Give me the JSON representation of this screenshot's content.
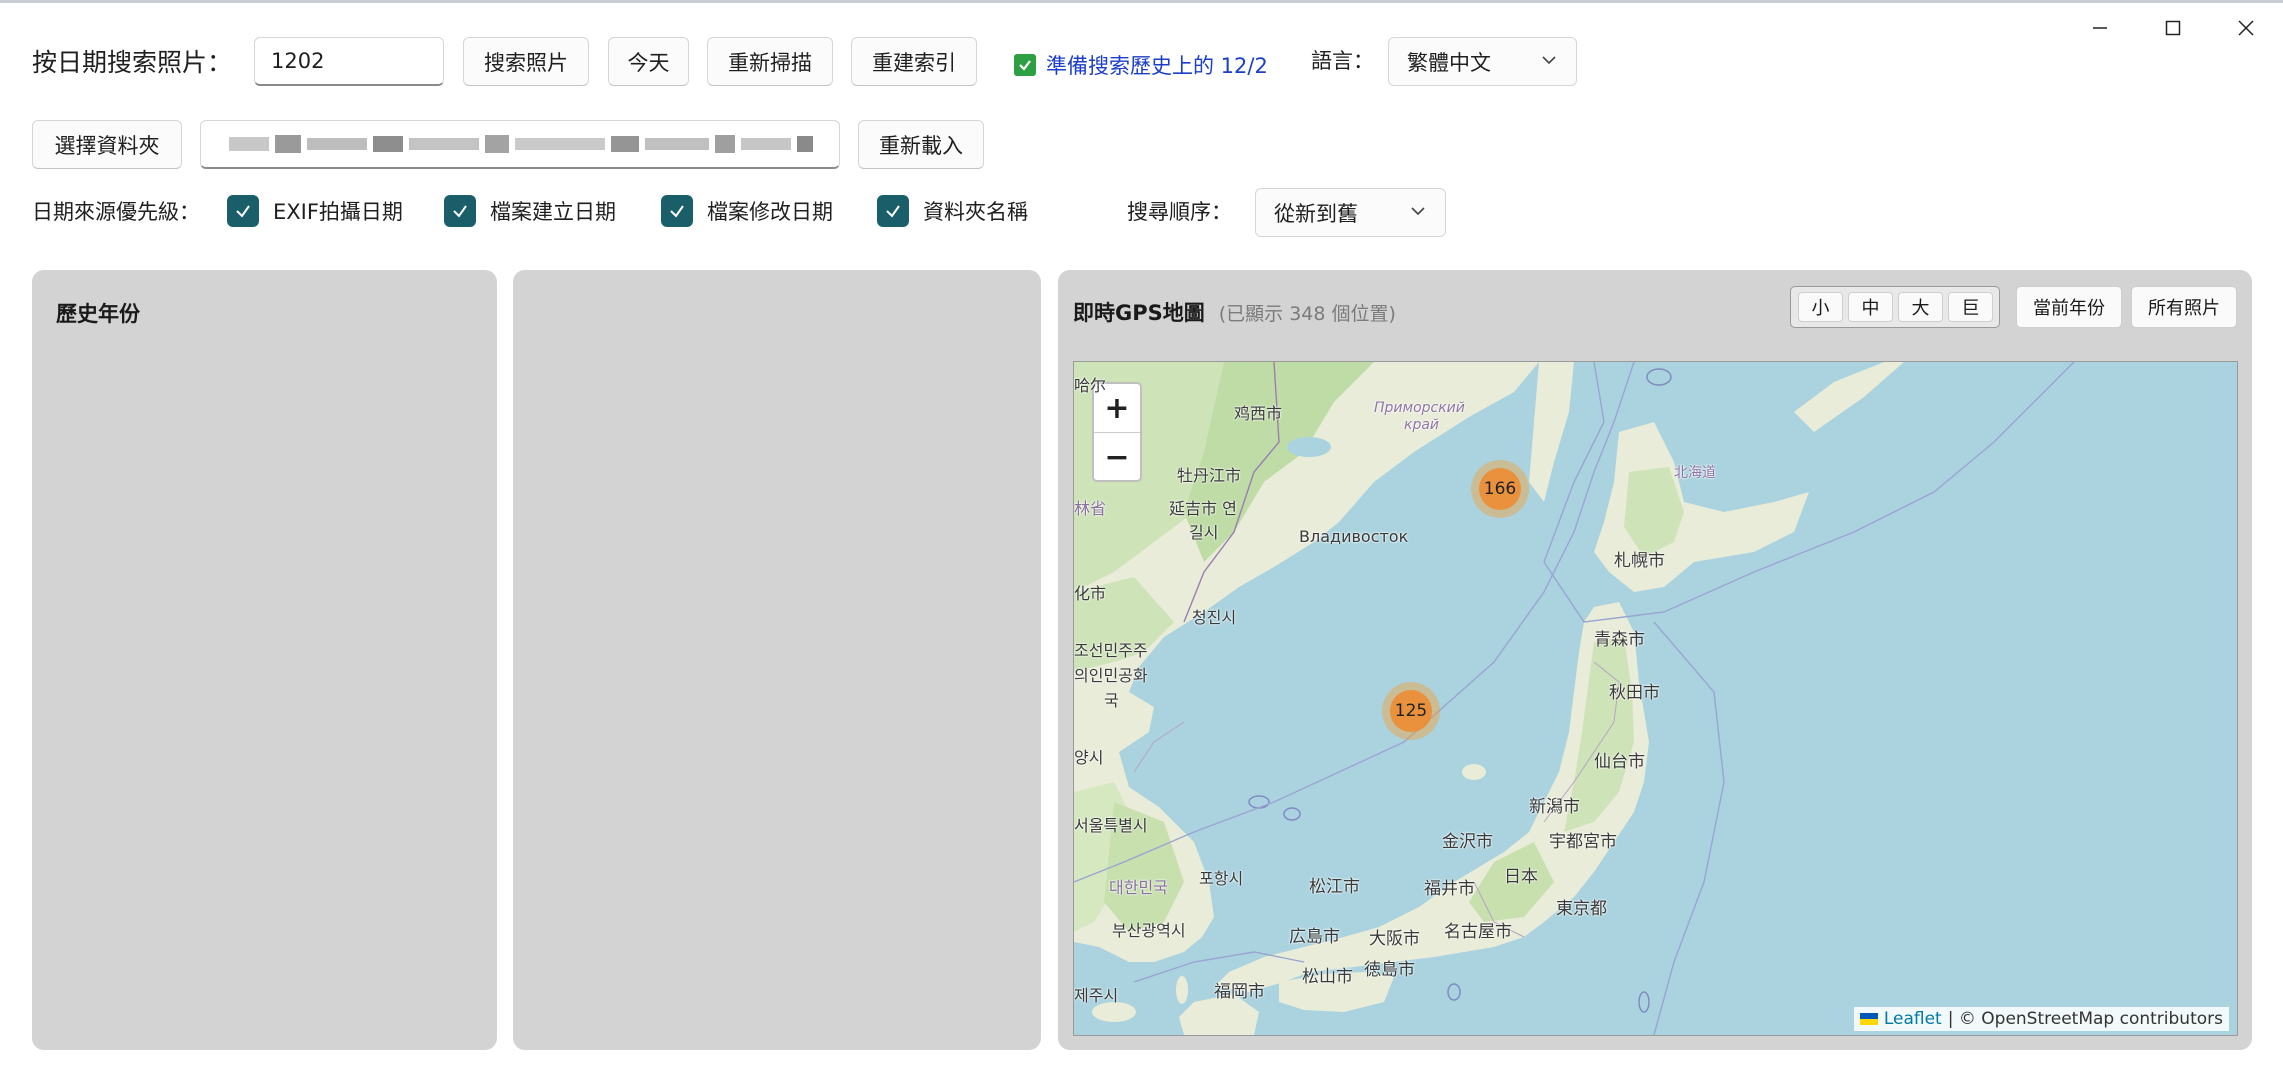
{
  "window": {
    "minimize": "minimize",
    "maximize": "maximize",
    "close": "close"
  },
  "search": {
    "label": "按日期搜索照片：",
    "date_value": "1202",
    "search_button": "搜索照片",
    "today_button": "今天",
    "rescan_button": "重新掃描",
    "rebuild_button": "重建索引",
    "status_text": "準備搜索歷史上的 12/2",
    "language_label": "語言：",
    "language_value": "繁體中文"
  },
  "folder": {
    "choose_button": "選擇資料夾",
    "reload_button": "重新載入"
  },
  "priority": {
    "label": "日期來源優先級：",
    "options": [
      {
        "label": "EXIF拍攝日期",
        "checked": true
      },
      {
        "label": "檔案建立日期",
        "checked": true
      },
      {
        "label": "檔案修改日期",
        "checked": true
      },
      {
        "label": "資料夾名稱",
        "checked": true
      }
    ],
    "order_label": "搜尋順序：",
    "order_value": "從新到舊"
  },
  "left_panel": {
    "title": "歷史年份"
  },
  "map_panel": {
    "title": "即時GPS地圖",
    "subtitle": "(已顯示 348 個位置)",
    "sizes": [
      "小",
      "中",
      "大",
      "巨"
    ],
    "current_year_button": "當前年份",
    "all_photos_button": "所有照片",
    "zoom_in": "+",
    "zoom_out": "−",
    "clusters": [
      {
        "count": "166"
      },
      {
        "count": "125"
      }
    ],
    "labels": {
      "l1": "哈尔",
      "l2": "鸡西市",
      "l3": "Приморский",
      "l4": "край",
      "l5": "牡丹江市",
      "l6": "延吉市 연",
      "l7": "길시",
      "l8": "林省",
      "l9": "Владивосток",
      "l10": "北海道",
      "l11": "札幌市",
      "l12": "化市",
      "l13": "청진시",
      "l14": "조선민주주",
      "l15": "의인민공화",
      "l16": "국",
      "l17": "青森市",
      "l18": "秋田市",
      "l19": "양시",
      "l20": "仙台市",
      "l21": "新潟市",
      "l22": "서울특별시",
      "l23": "金沢市",
      "l24": "宇都宮市",
      "l25": "日本",
      "l26": "포항시",
      "l27": "대한민국",
      "l28": "松江市",
      "l29": "福井市",
      "l30": "東京都",
      "l31": "부산광역시",
      "l32": "名古屋市",
      "l33": "広島市",
      "l34": "大阪市",
      "l35": "徳島市",
      "l36": "松山市",
      "l37": "福岡市",
      "l38": "제주시"
    },
    "attribution_link": "Leaflet",
    "attribution_text": "| © OpenStreetMap contributors"
  },
  "colors": {
    "checkbox": "#1a5e6a",
    "status_text": "#1b3fc6",
    "panel_bg": "#d3d3d3",
    "sea": "#aad3df",
    "land": "#f2efe9",
    "cluster": "#ec8c32"
  }
}
